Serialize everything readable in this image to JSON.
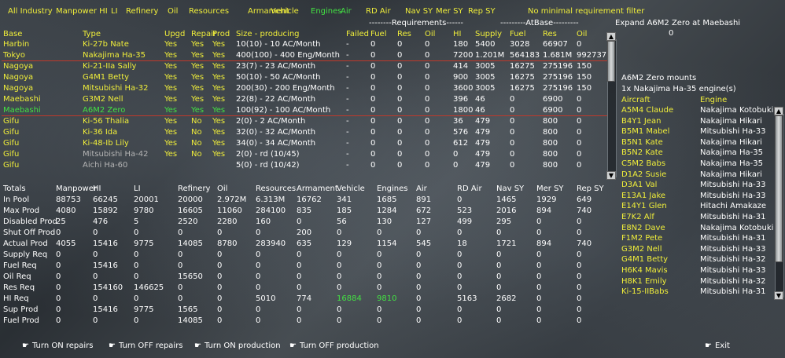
{
  "menu": [
    "All Industry",
    "Manpower HI",
    "LI",
    "Refinery",
    "Oil",
    "Resources",
    "Armament",
    "Vehicle",
    "Engines",
    "Air",
    "RD Air",
    "Nav SY",
    "Mer SY",
    "Rep SY",
    "No minimal requirement filter"
  ],
  "menu_active_index": 8,
  "group_headers": {
    "requirements": "--------Requirements------",
    "atbase": "---------AtBase---------"
  },
  "columns": [
    "Base",
    "Type",
    "Upgd",
    "Repair",
    "Prod",
    "Size - producing",
    "Failed",
    "Fuel",
    "Res",
    "Oil",
    "HI",
    "Supply",
    "Fuel",
    "Res",
    "Oil"
  ],
  "rows": [
    {
      "c": [
        "Harbin",
        "Ki-27b Nate",
        "Yes",
        "Yes",
        "Yes",
        "10(10) - 10 AC/Month",
        "-",
        "0",
        "0",
        "0",
        "180",
        "5400",
        "3028",
        "66907",
        "0"
      ],
      "style": "y"
    },
    {
      "c": [
        "Tokyo",
        "Nakajima Ha-35",
        "Yes",
        "Yes",
        "Yes",
        "400(100) - 400 Eng/Month",
        "-",
        "0",
        "0",
        "0",
        "7200",
        "1.201M",
        "564183",
        "1.681M",
        "992737"
      ],
      "style": "y",
      "line": true
    },
    {
      "c": [
        "Nagoya",
        "Ki-21-IIa Sally",
        "Yes",
        "Yes",
        "Yes",
        "23(7) - 23 AC/Month",
        "-",
        "0",
        "0",
        "0",
        "414",
        "3005",
        "16275",
        "275196",
        "150"
      ],
      "style": "y"
    },
    {
      "c": [
        "Nagoya",
        "G4M1 Betty",
        "Yes",
        "Yes",
        "Yes",
        "50(10) - 50 AC/Month",
        "-",
        "0",
        "0",
        "0",
        "900",
        "3005",
        "16275",
        "275196",
        "150"
      ],
      "style": "y"
    },
    {
      "c": [
        "Nagoya",
        "Mitsubishi Ha-32",
        "Yes",
        "Yes",
        "Yes",
        "200(30) - 200 Eng/Month",
        "-",
        "0",
        "0",
        "0",
        "3600",
        "3005",
        "16275",
        "275196",
        "150"
      ],
      "style": "y"
    },
    {
      "c": [
        "Maebashi",
        "G3M2 Nell",
        "Yes",
        "Yes",
        "Yes",
        "22(8) - 22 AC/Month",
        "-",
        "0",
        "0",
        "0",
        "396",
        "46",
        "0",
        "6900",
        "0"
      ],
      "style": "y"
    },
    {
      "c": [
        "Maebashi",
        "A6M2 Zero",
        "Yes",
        "Yes",
        "Yes",
        "100(92) - 100 AC/Month",
        "-",
        "0",
        "0",
        "0",
        "1800",
        "46",
        "0",
        "6900",
        "0"
      ],
      "style": "g",
      "line": true
    },
    {
      "c": [
        "Gifu",
        "Ki-56 Thalia",
        "Yes",
        "No",
        "Yes",
        "2(0) - 2 AC/Month",
        "-",
        "0",
        "0",
        "0",
        "36",
        "479",
        "0",
        "800",
        "0"
      ],
      "style": "y"
    },
    {
      "c": [
        "Gifu",
        "Ki-36 Ida",
        "Yes",
        "No",
        "Yes",
        "32(0) - 32 AC/Month",
        "-",
        "0",
        "0",
        "0",
        "576",
        "479",
        "0",
        "800",
        "0"
      ],
      "style": "y"
    },
    {
      "c": [
        "Gifu",
        "Ki-48-Ib Lily",
        "Yes",
        "No",
        "Yes",
        "34(0) - 34 AC/Month",
        "-",
        "0",
        "0",
        "0",
        "612",
        "479",
        "0",
        "800",
        "0"
      ],
      "style": "y"
    },
    {
      "c": [
        "Gifu",
        "Mitsubishi Ha-42",
        "Yes",
        "No",
        "Yes",
        "2(0) - rd (10/45)",
        "-",
        "0",
        "0",
        "0",
        "0",
        "479",
        "0",
        "800",
        "0"
      ],
      "style": "gr"
    },
    {
      "c": [
        "Gifu",
        "Aichi Ha-60",
        "",
        "",
        "",
        "5(0) - rd (10/42)",
        "-",
        "0",
        "0",
        "0",
        "0",
        "479",
        "0",
        "800",
        "0"
      ],
      "style": "gr"
    }
  ],
  "totals_columns": [
    "Totals",
    "Manpower",
    "HI",
    "LI",
    "Refinery",
    "Oil",
    "Resources",
    "Armament",
    "Vehicle",
    "Engines",
    "Air",
    "RD Air",
    "Nav SY",
    "Mer SY",
    "Rep SY"
  ],
  "totals": [
    [
      "In Pool",
      "88753",
      "66245",
      "20001",
      "20000",
      "2.972M",
      "6.313M",
      "16762",
      "341",
      "1685",
      "891",
      "0",
      "1465",
      "1929",
      "649"
    ],
    [
      "Max Prod",
      "4080",
      "15892",
      "9780",
      "16605",
      "11060",
      "284100",
      "835",
      "185",
      "1284",
      "672",
      "523",
      "2016",
      "894",
      "740"
    ],
    [
      "Disabled Prod",
      "25",
      "476",
      "5",
      "2520",
      "2280",
      "160",
      "0",
      "56",
      "130",
      "127",
      "499",
      "295",
      "0",
      "0"
    ],
    [
      "Shut Off Prod",
      "0",
      "0",
      "0",
      "0",
      "0",
      "0",
      "200",
      "0",
      "0",
      "0",
      "0",
      "0",
      "0",
      "0"
    ],
    [
      "Actual Prod",
      "4055",
      "15416",
      "9775",
      "14085",
      "8780",
      "283940",
      "635",
      "129",
      "1154",
      "545",
      "18",
      "1721",
      "894",
      "740"
    ],
    [
      "Supply Req",
      "0",
      "0",
      "0",
      "0",
      "0",
      "0",
      "0",
      "0",
      "0",
      "0",
      "0",
      "0",
      "0",
      "0"
    ],
    [
      "Fuel Req",
      "0",
      "15416",
      "0",
      "0",
      "0",
      "0",
      "0",
      "0",
      "0",
      "0",
      "0",
      "0",
      "0",
      "0"
    ],
    [
      "Oil Req",
      "0",
      "0",
      "0",
      "15650",
      "0",
      "0",
      "0",
      "0",
      "0",
      "0",
      "0",
      "0",
      "0",
      "0"
    ],
    [
      "Res Req",
      "0",
      "154160",
      "146625",
      "0",
      "0",
      "0",
      "0",
      "0",
      "0",
      "0",
      "0",
      "0",
      "0",
      "0"
    ],
    [
      "HI Req",
      "0",
      "0",
      "0",
      "0",
      "0",
      "5010",
      "774",
      "16884",
      "9810",
      "0",
      "5163",
      "2682",
      "0",
      "0"
    ],
    [
      "Sup Prod",
      "0",
      "15416",
      "9775",
      "1565",
      "0",
      "0",
      "0",
      "0",
      "0",
      "0",
      "0",
      "0",
      "0",
      "0"
    ],
    [
      "Fuel Prod",
      "0",
      "0",
      "0",
      "14085",
      "0",
      "0",
      "0",
      "0",
      "0",
      "0",
      "0",
      "0",
      "0",
      "0"
    ]
  ],
  "totals_green": [
    [
      9,
      8
    ],
    [
      9,
      9
    ]
  ],
  "right": {
    "expand_label": "Expand A6M2 Zero at Maebashi",
    "expand_value": "0",
    "mounts_title": "A6M2 Zero mounts",
    "mounts_line": "1x Nakajima Ha-35 engine(s)",
    "headers": [
      "Aircraft",
      "Engine"
    ],
    "aircraft": [
      [
        "A5M4 Claude",
        "Nakajima Kotobuki"
      ],
      [
        "B4Y1 Jean",
        "Nakajima Hikari"
      ],
      [
        "B5M1 Mabel",
        "Mitsubishi Ha-33"
      ],
      [
        "B5N1 Kate",
        "Nakajima Hikari"
      ],
      [
        "B5N2 Kate",
        "Nakajima Ha-35"
      ],
      [
        "C5M2 Babs",
        "Nakajima Ha-35"
      ],
      [
        "D1A2 Susie",
        "Nakajima Hikari"
      ],
      [
        "D3A1 Val",
        "Mitsubishi Ha-33"
      ],
      [
        "E13A1 Jake",
        "Mitsubishi Ha-33"
      ],
      [
        "E14Y1 Glen",
        "Hitachi Amakaze"
      ],
      [
        "E7K2 Alf",
        "Mitsubishi Ha-31"
      ],
      [
        "E8N2 Dave",
        "Nakajima Kotobuki"
      ],
      [
        "F1M2 Pete",
        "Mitsubishi Ha-31"
      ],
      [
        "G3M2 Nell",
        "Mitsubishi Ha-33"
      ],
      [
        "G4M1 Betty",
        "Mitsubishi Ha-32"
      ],
      [
        "H6K4 Mavis",
        "Mitsubishi Ha-33"
      ],
      [
        "H8K1 Emily",
        "Mitsubishi Ha-32"
      ],
      [
        "Ki-15-IIBabs",
        "Mitsubishi Ha-31"
      ]
    ]
  },
  "buttons": [
    "Turn ON repairs",
    "Turn OFF repairs",
    "Turn ON production",
    "Turn OFF production"
  ],
  "exit_label": "Exit",
  "colors": {
    "yellow": "#f0ee3a",
    "green": "#43e043",
    "gray": "#b4b4b4",
    "red_line": "#c0392b"
  }
}
